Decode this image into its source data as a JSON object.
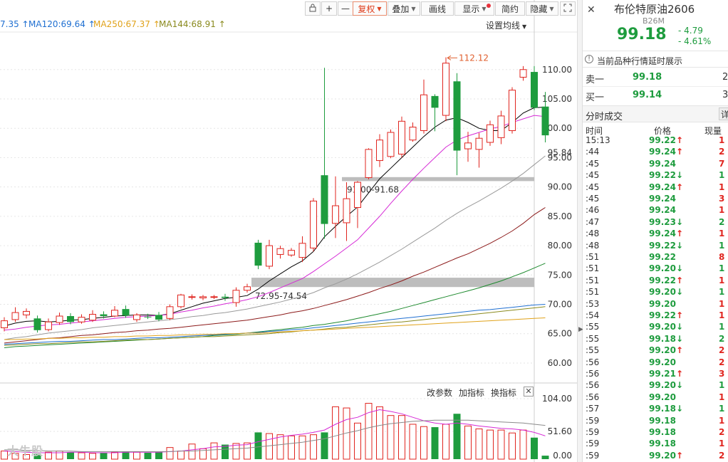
{
  "toolbar": {
    "buttons": [
      {
        "label": "",
        "icon": "lock-icon"
      },
      {
        "label": "+",
        "icon": "zoom-in-icon"
      },
      {
        "label": "—",
        "icon": "zoom-out-icon"
      },
      {
        "label": "复权",
        "active": true,
        "dropdown": true
      },
      {
        "label": "叠加",
        "dropdown": true
      },
      {
        "label": "画线"
      },
      {
        "label": "显示",
        "dropdown": true,
        "dot": true
      },
      {
        "label": "简约"
      },
      {
        "label": "隐藏",
        "dropdown": true
      },
      {
        "label": "",
        "icon": "fullscreen-icon"
      }
    ]
  },
  "ma_legend": [
    {
      "text": "7.35",
      "arrow": "↑",
      "color": "#1f6fd1"
    },
    {
      "text": "MA120:69.64",
      "arrow": "↑",
      "color": "#1f6fd1"
    },
    {
      "text": "MA250:67.37",
      "arrow": "↑",
      "color": "#e0a21a"
    },
    {
      "text": "MA144:68.91",
      "arrow": "↑",
      "color": "#8a8a1e"
    }
  ],
  "setting_ma": "设置均线",
  "annotations": {
    "high_label": "112.12",
    "band1_label": "91.00-91.68",
    "band2_label": "72.95-74.54",
    "last_price_label": "95.84"
  },
  "subchart": {
    "change_params": "改参数",
    "add_indicator": "加指标",
    "switch_indicator": "换指标",
    "close": "✕",
    "axis": [
      "104.00",
      "51.60",
      "0.00"
    ]
  },
  "watermark": "大牛股 ",
  "colors": {
    "up": "#e0251f",
    "down": "#1e9c3e",
    "band": "#bdbdbd"
  },
  "chart_data": {
    "type": "candlestick",
    "y_axis_ticks": [
      110,
      105,
      100,
      95,
      90,
      85,
      80,
      75,
      70,
      65,
      60
    ],
    "y_axis_labels": [
      "110.00",
      "105.00",
      "100.00",
      "95.00",
      "90.00",
      "85.00",
      "80.00",
      "75.00",
      "70.00",
      "65.00",
      "60.00"
    ],
    "ylim": [
      56.6,
      116.4
    ],
    "high": 112.12,
    "bands": [
      [
        91.0,
        91.68
      ],
      [
        72.95,
        74.54
      ]
    ],
    "last_price": 95.84,
    "candles": [
      {
        "o": 66.0,
        "c": 67.2,
        "h": 67.8,
        "l": 65.4
      },
      {
        "o": 67.4,
        "c": 68.6,
        "h": 69.5,
        "l": 67.0
      },
      {
        "o": 68.2,
        "c": 68.8,
        "h": 69.3,
        "l": 67.6
      },
      {
        "o": 67.6,
        "c": 65.6,
        "h": 68.1,
        "l": 65.2
      },
      {
        "o": 65.7,
        "c": 67.0,
        "h": 67.6,
        "l": 65.4
      },
      {
        "o": 66.9,
        "c": 68.0,
        "h": 68.6,
        "l": 66.5
      },
      {
        "o": 68.0,
        "c": 67.0,
        "h": 68.5,
        "l": 66.6
      },
      {
        "o": 67.0,
        "c": 67.8,
        "h": 68.3,
        "l": 66.7
      },
      {
        "o": 67.3,
        "c": 68.3,
        "h": 69.0,
        "l": 67.0
      },
      {
        "o": 68.3,
        "c": 68.0,
        "h": 68.8,
        "l": 67.6
      },
      {
        "o": 68.0,
        "c": 69.0,
        "h": 69.7,
        "l": 67.8
      },
      {
        "o": 69.2,
        "c": 68.1,
        "h": 69.8,
        "l": 67.7
      },
      {
        "o": 67.4,
        "c": 68.2,
        "h": 68.5,
        "l": 67.0
      },
      {
        "o": 67.9,
        "c": 67.8,
        "h": 68.4,
        "l": 67.5
      },
      {
        "o": 68.2,
        "c": 67.4,
        "h": 68.7,
        "l": 67.1
      },
      {
        "o": 67.6,
        "c": 69.6,
        "h": 70.0,
        "l": 67.3
      },
      {
        "o": 69.6,
        "c": 71.6,
        "h": 71.8,
        "l": 69.3
      },
      {
        "o": 71.2,
        "c": 71.3,
        "h": 71.7,
        "l": 70.8
      },
      {
        "o": 71.1,
        "c": 71.3,
        "h": 71.6,
        "l": 70.7
      },
      {
        "o": 71.2,
        "c": 71.3,
        "h": 71.6,
        "l": 70.9
      },
      {
        "o": 71.3,
        "c": 71.1,
        "h": 71.8,
        "l": 70.6
      },
      {
        "o": 70.3,
        "c": 72.4,
        "h": 72.9,
        "l": 69.6
      },
      {
        "o": 72.4,
        "c": 73.0,
        "h": 73.5,
        "l": 72.0
      },
      {
        "o": 80.5,
        "c": 76.6,
        "h": 81.0,
        "l": 76.0
      },
      {
        "o": 76.5,
        "c": 80.0,
        "h": 81.0,
        "l": 76.0
      },
      {
        "o": 78.5,
        "c": 79.5,
        "h": 80.0,
        "l": 77.8
      },
      {
        "o": 78.4,
        "c": 79.2,
        "h": 79.6,
        "l": 78.1
      },
      {
        "o": 78.0,
        "c": 80.4,
        "h": 81.6,
        "l": 77.2
      },
      {
        "o": 79.6,
        "c": 87.6,
        "h": 88.1,
        "l": 79.0
      },
      {
        "o": 92.0,
        "c": 83.7,
        "h": 110.3,
        "l": 81.2
      },
      {
        "o": 83.8,
        "c": 86.8,
        "h": 91.8,
        "l": 81.3
      },
      {
        "o": 83.9,
        "c": 88.0,
        "h": 90.8,
        "l": 80.8
      },
      {
        "o": 86.5,
        "c": 90.8,
        "h": 91.0,
        "l": 83.0
      },
      {
        "o": 91.6,
        "c": 96.4,
        "h": 96.6,
        "l": 91.3
      },
      {
        "o": 94.5,
        "c": 98.0,
        "h": 99.0,
        "l": 93.4
      },
      {
        "o": 95.2,
        "c": 99.3,
        "h": 99.8,
        "l": 94.9
      },
      {
        "o": 95.6,
        "c": 101.2,
        "h": 102.0,
        "l": 95.0
      },
      {
        "o": 98.0,
        "c": 100.2,
        "h": 101.0,
        "l": 97.7
      },
      {
        "o": 99.6,
        "c": 105.7,
        "h": 108.3,
        "l": 99.1
      },
      {
        "o": 105.5,
        "c": 103.5,
        "h": 105.8,
        "l": 99.5
      },
      {
        "o": 102.2,
        "c": 111.1,
        "h": 112.1,
        "l": 101.2
      },
      {
        "o": 108.0,
        "c": 96.2,
        "h": 109.4,
        "l": 92.0
      },
      {
        "o": 96.5,
        "c": 97.5,
        "h": 99.4,
        "l": 94.3
      },
      {
        "o": 96.4,
        "c": 98.3,
        "h": 99.2,
        "l": 93.3
      },
      {
        "o": 97.6,
        "c": 100.6,
        "h": 101.3,
        "l": 97.0
      },
      {
        "o": 98.4,
        "c": 102.1,
        "h": 103.0,
        "l": 97.3
      },
      {
        "o": 99.6,
        "c": 106.5,
        "h": 107.0,
        "l": 99.1
      },
      {
        "o": 108.7,
        "c": 110.0,
        "h": 110.6,
        "l": 108.1
      },
      {
        "o": 109.6,
        "c": 103.5,
        "h": 110.6,
        "l": 103.1
      },
      {
        "o": 103.7,
        "c": 98.8,
        "h": 106.2,
        "l": 97.6
      }
    ],
    "ma_lines": [
      {
        "color": "#000000",
        "values": [
          66.3,
          66.8,
          67.1,
          67.2,
          67.0,
          67.1,
          67.3,
          67.4,
          67.6,
          67.8,
          68.0,
          68.1,
          68.2,
          68.2,
          68.1,
          68.4,
          69.0,
          69.6,
          70.2,
          70.6,
          71.0,
          71.2,
          71.5,
          72.6,
          74.0,
          75.2,
          76.4,
          77.4,
          79.0,
          81.5,
          83.3,
          85.0,
          86.6,
          89.0,
          91.4,
          93.2,
          95.0,
          96.8,
          98.6,
          100.2,
          101.4,
          101.8,
          101.0,
          100.0,
          99.6,
          99.6,
          101.0,
          102.6,
          103.5,
          103.6
        ]
      },
      {
        "color": "#d62ad6",
        "values": [
          65.6,
          65.8,
          66.1,
          66.3,
          66.5,
          66.6,
          66.8,
          67.0,
          67.2,
          67.4,
          67.6,
          67.8,
          67.9,
          68.0,
          68.1,
          68.3,
          68.7,
          69.0,
          69.4,
          69.7,
          70.1,
          70.4,
          70.8,
          71.3,
          72.0,
          72.8,
          73.6,
          74.4,
          75.6,
          76.9,
          78.2,
          79.6,
          81.0,
          83.0,
          85.0,
          87.2,
          89.3,
          91.3,
          93.2,
          95.0,
          96.8,
          98.0,
          98.7,
          99.3,
          99.9,
          100.3,
          101.0,
          101.6,
          102.2,
          102.0
        ]
      },
      {
        "color": "#9a9a9a",
        "values": [
          64.0,
          64.3,
          64.5,
          64.8,
          65.1,
          65.3,
          65.5,
          65.7,
          66.0,
          66.2,
          66.4,
          66.6,
          66.8,
          67.0,
          67.2,
          67.4,
          67.6,
          67.9,
          68.1,
          68.4,
          68.6,
          68.9,
          69.2,
          69.6,
          70.0,
          70.4,
          70.9,
          71.4,
          72.0,
          72.8,
          73.5,
          74.3,
          75.2,
          76.2,
          77.2,
          78.3,
          79.4,
          80.6,
          81.8,
          83.0,
          84.3,
          85.5,
          86.6,
          87.6,
          88.7,
          89.8,
          91.0,
          92.3,
          93.8,
          95.3
        ]
      },
      {
        "color": "#8c1a1a",
        "values": [
          63.4,
          63.6,
          63.8,
          64.0,
          64.2,
          64.3,
          64.5,
          64.7,
          64.8,
          65.0,
          65.2,
          65.3,
          65.5,
          65.6,
          65.8,
          65.9,
          66.1,
          66.3,
          66.5,
          66.7,
          66.9,
          67.1,
          67.3,
          67.6,
          67.9,
          68.2,
          68.6,
          68.9,
          69.3,
          69.8,
          70.3,
          70.8,
          71.4,
          72.0,
          72.7,
          73.3,
          74.0,
          74.8,
          75.5,
          76.3,
          77.1,
          77.9,
          78.6,
          79.5,
          80.4,
          81.4,
          82.5,
          83.8,
          85.3,
          86.5
        ]
      },
      {
        "color": "#1e8a2e",
        "values": [
          62.6,
          62.8,
          62.9,
          63.0,
          63.1,
          63.2,
          63.3,
          63.4,
          63.5,
          63.6,
          63.7,
          63.8,
          63.9,
          64.0,
          64.1,
          64.2,
          64.3,
          64.4,
          64.5,
          64.7,
          64.8,
          64.9,
          65.1,
          65.3,
          65.5,
          65.7,
          65.9,
          66.1,
          66.4,
          66.6,
          66.9,
          67.2,
          67.6,
          68.0,
          68.4,
          68.8,
          69.3,
          69.8,
          70.3,
          70.8,
          71.3,
          71.8,
          72.3,
          72.8,
          73.4,
          74.0,
          74.7,
          75.4,
          76.2,
          77.0
        ]
      },
      {
        "color": "#1f6fd1",
        "values": [
          63.2,
          63.3,
          63.4,
          63.5,
          63.6,
          63.7,
          63.7,
          63.8,
          63.9,
          64.0,
          64.0,
          64.1,
          64.2,
          64.3,
          64.3,
          64.4,
          64.5,
          64.6,
          64.7,
          64.8,
          64.9,
          65.0,
          65.1,
          65.2,
          65.4,
          65.5,
          65.7,
          65.8,
          66.0,
          66.2,
          66.4,
          66.6,
          66.8,
          67.0,
          67.2,
          67.4,
          67.6,
          67.8,
          68.0,
          68.2,
          68.4,
          68.6,
          68.8,
          69.0,
          69.1,
          69.3,
          69.5,
          69.7,
          69.9,
          70.0
        ]
      },
      {
        "color": "#8a8a1e",
        "values": [
          63.0,
          63.1,
          63.2,
          63.3,
          63.3,
          63.4,
          63.5,
          63.6,
          63.6,
          63.7,
          63.8,
          63.9,
          64.0,
          64.0,
          64.1,
          64.2,
          64.3,
          64.4,
          64.5,
          64.5,
          64.6,
          64.7,
          64.8,
          64.9,
          65.0,
          65.2,
          65.3,
          65.5,
          65.6,
          65.8,
          66.0,
          66.1,
          66.3,
          66.5,
          66.7,
          66.9,
          67.0,
          67.2,
          67.4,
          67.6,
          67.8,
          68.0,
          68.2,
          68.4,
          68.6,
          68.8,
          69.0,
          69.2,
          69.4,
          69.6
        ]
      },
      {
        "color": "#e0a21a",
        "values": [
          64.0,
          64.0,
          64.1,
          64.1,
          64.2,
          64.2,
          64.3,
          64.3,
          64.4,
          64.4,
          64.5,
          64.5,
          64.6,
          64.6,
          64.7,
          64.7,
          64.8,
          64.8,
          64.9,
          64.9,
          65.0,
          65.0,
          65.1,
          65.1,
          65.2,
          65.3,
          65.4,
          65.5,
          65.6,
          65.7,
          65.8,
          65.9,
          66.0,
          66.1,
          66.2,
          66.3,
          66.4,
          66.5,
          66.6,
          66.7,
          66.8,
          66.9,
          67.0,
          67.1,
          67.2,
          67.3,
          67.4,
          67.5,
          67.6,
          67.7
        ]
      }
    ],
    "volume": {
      "ylim": [
        0,
        104.0
      ],
      "values": [
        14,
        10,
        8,
        9,
        12,
        14,
        12,
        11,
        10,
        11,
        12,
        13,
        12,
        11,
        12,
        20,
        14,
        26,
        18,
        28,
        25,
        27,
        28,
        46,
        44,
        42,
        40,
        40,
        42,
        46,
        90,
        88,
        62,
        96,
        90,
        75,
        75,
        60,
        56,
        55,
        60,
        78,
        57,
        52,
        50,
        50,
        45,
        50,
        37,
        6
      ],
      "ma1": [
        14,
        13,
        12,
        11,
        11,
        11,
        12,
        12,
        11,
        11,
        11,
        12,
        12,
        12,
        12,
        13,
        14,
        16,
        18,
        21,
        22,
        24,
        25,
        30,
        34,
        38,
        41,
        43,
        46,
        50,
        60,
        68,
        72,
        80,
        85,
        82,
        78,
        72,
        66,
        62,
        60,
        62,
        60,
        57,
        55,
        53,
        52,
        50,
        46,
        40
      ],
      "ma2": [
        16,
        16,
        15,
        15,
        14,
        14,
        14,
        13,
        13,
        13,
        13,
        13,
        13,
        13,
        13,
        13,
        14,
        14,
        15,
        16,
        17,
        18,
        19,
        21,
        23,
        25,
        27,
        29,
        32,
        35,
        40,
        45,
        49,
        54,
        58,
        61,
        63,
        65,
        66,
        67,
        67,
        67,
        67,
        66,
        65,
        64,
        63,
        62,
        60,
        58
      ]
    }
  },
  "quote": {
    "title": "布伦特原油2606",
    "code": "B26M",
    "price": "99.18",
    "change": "- 4.79",
    "change_pct": "- 4.61%",
    "delay_notice": "当前品种行情延时展示",
    "ask_label": "卖一",
    "ask_price": "99.18",
    "ask_vol": "2",
    "bid_label": "买一",
    "bid_price": "99.14",
    "bid_vol": "3",
    "ticks_title": "分时成交",
    "ticks_detail": "详",
    "cols": [
      "时间",
      "价格",
      "现量"
    ],
    "ticks": [
      {
        "t": "15:13",
        "p": "99.22",
        "dir": "up",
        "v": "1"
      },
      {
        "t": ":44",
        "p": "99.24",
        "dir": "up",
        "v": "2"
      },
      {
        "t": ":45",
        "p": "99.24",
        "dir": "",
        "v": "7"
      },
      {
        "t": ":45",
        "p": "99.22",
        "dir": "dn",
        "v": "1"
      },
      {
        "t": ":45",
        "p": "99.24",
        "dir": "up",
        "v": "1"
      },
      {
        "t": ":45",
        "p": "99.24",
        "dir": "",
        "v": "3"
      },
      {
        "t": ":46",
        "p": "99.24",
        "dir": "",
        "v": "1"
      },
      {
        "t": ":47",
        "p": "99.23",
        "dir": "dn",
        "v": "2"
      },
      {
        "t": ":48",
        "p": "99.24",
        "dir": "up",
        "v": "1"
      },
      {
        "t": ":48",
        "p": "99.22",
        "dir": "dn",
        "v": "1"
      },
      {
        "t": ":51",
        "p": "99.22",
        "dir": "",
        "v": "8"
      },
      {
        "t": ":51",
        "p": "99.20",
        "dir": "dn",
        "v": "1"
      },
      {
        "t": ":51",
        "p": "99.22",
        "dir": "up",
        "v": "1"
      },
      {
        "t": ":51",
        "p": "99.20",
        "dir": "dn",
        "v": "1"
      },
      {
        "t": ":53",
        "p": "99.20",
        "dir": "",
        "v": "1"
      },
      {
        "t": ":54",
        "p": "99.22",
        "dir": "up",
        "v": "1"
      },
      {
        "t": ":55",
        "p": "99.20",
        "dir": "dn",
        "v": "1"
      },
      {
        "t": ":55",
        "p": "99.18",
        "dir": "dn",
        "v": "2"
      },
      {
        "t": ":55",
        "p": "99.20",
        "dir": "up",
        "v": "2"
      },
      {
        "t": ":56",
        "p": "99.20",
        "dir": "",
        "v": "2"
      },
      {
        "t": ":56",
        "p": "99.21",
        "dir": "up",
        "v": "3"
      },
      {
        "t": ":56",
        "p": "99.20",
        "dir": "dn",
        "v": "1"
      },
      {
        "t": ":56",
        "p": "99.20",
        "dir": "",
        "v": "1"
      },
      {
        "t": ":57",
        "p": "99.18",
        "dir": "dn",
        "v": "1"
      },
      {
        "t": ":59",
        "p": "99.18",
        "dir": "",
        "v": "1"
      },
      {
        "t": ":59",
        "p": "99.18",
        "dir": "",
        "v": "2"
      },
      {
        "t": ":59",
        "p": "99.18",
        "dir": "",
        "v": "1"
      },
      {
        "t": ":59",
        "p": "99.20",
        "dir": "up",
        "v": "2"
      }
    ]
  }
}
